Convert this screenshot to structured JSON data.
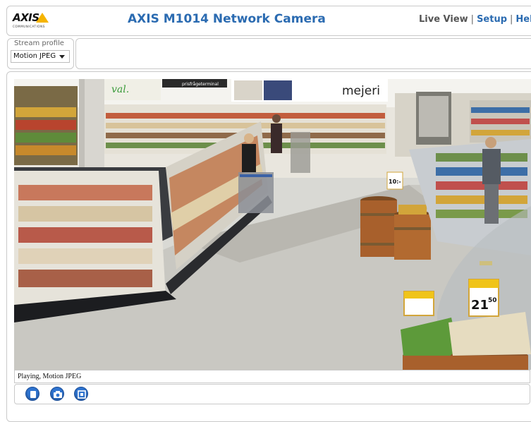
{
  "header": {
    "logo_text": "AXIS",
    "logo_sub": "COMMUNICATIONS",
    "title": "AXIS M1014 Network Camera",
    "nav": {
      "live_view": "Live View",
      "separator": "|",
      "setup": "Setup",
      "help": "Help"
    }
  },
  "stream_profile": {
    "label": "Stream profile",
    "selected": "Motion JPEG"
  },
  "video": {
    "sign_dept": "mejeri",
    "sign_val": "val.",
    "sign_terminal": "prisfrågeterminal",
    "price_tag_1": "21",
    "price_tag_1_cents": "50",
    "price_tag_small": "10:-"
  },
  "status": {
    "text": "Playing, Motion JPEG"
  },
  "controls": {
    "icons": [
      "stop-icon",
      "snapshot-icon",
      "fullscreen-icon"
    ]
  },
  "colors": {
    "brand_blue": "#2b6bb1",
    "logo_yellow": "#f5b400",
    "button_blue": "#2f74d0"
  }
}
